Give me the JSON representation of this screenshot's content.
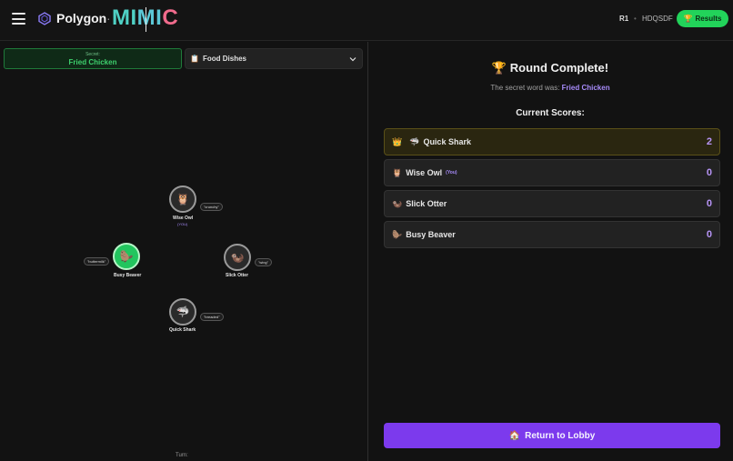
{
  "header": {
    "brand": "Polygon",
    "separator": "·",
    "title_part1": "MI",
    "title_part2": "MI",
    "title_part3": "C",
    "round": "R1",
    "dot": "•",
    "room_code": "HDQSDF",
    "results_label": "Results",
    "results_icon": "trophy-icon"
  },
  "secret": {
    "label": "Secret:",
    "word": "Fried Chicken"
  },
  "category": {
    "icon": "clipboard-icon",
    "label": "Food Dishes"
  },
  "players": [
    {
      "name": "Wise Owl",
      "you": "(YOU)",
      "emoji": "🦉",
      "word": "\"crunchy\""
    },
    {
      "name": "Busy Beaver",
      "emoji": "🦫",
      "word": "\"buttermilk\"",
      "active": true
    },
    {
      "name": "Slick Otter",
      "emoji": "🦦",
      "word": "\"wing\""
    },
    {
      "name": "Quick Shark",
      "emoji": "🦈",
      "word": "\"breaded\""
    }
  ],
  "turn_label": "Turn:",
  "results": {
    "title_emoji": "🏆",
    "title": "Round Complete!",
    "secret_prefix": "The secret word was:",
    "secret_word": "Fried Chicken",
    "scores_heading": "Current Scores:",
    "scores": [
      {
        "emoji": "🦈",
        "name": "Quick Shark",
        "score": "2",
        "crown": "👑",
        "lead": true
      },
      {
        "emoji": "🦉",
        "name": "Wise Owl",
        "you": "(You)",
        "score": "0"
      },
      {
        "emoji": "🦦",
        "name": "Slick Otter",
        "score": "0"
      },
      {
        "emoji": "🦫",
        "name": "Busy Beaver",
        "score": "0"
      }
    ],
    "return_emoji": "🏠",
    "return_label": "Return to Lobby"
  },
  "colors": {
    "accent": "#7c3aed",
    "success": "#22d35a",
    "score": "#b794f6"
  }
}
